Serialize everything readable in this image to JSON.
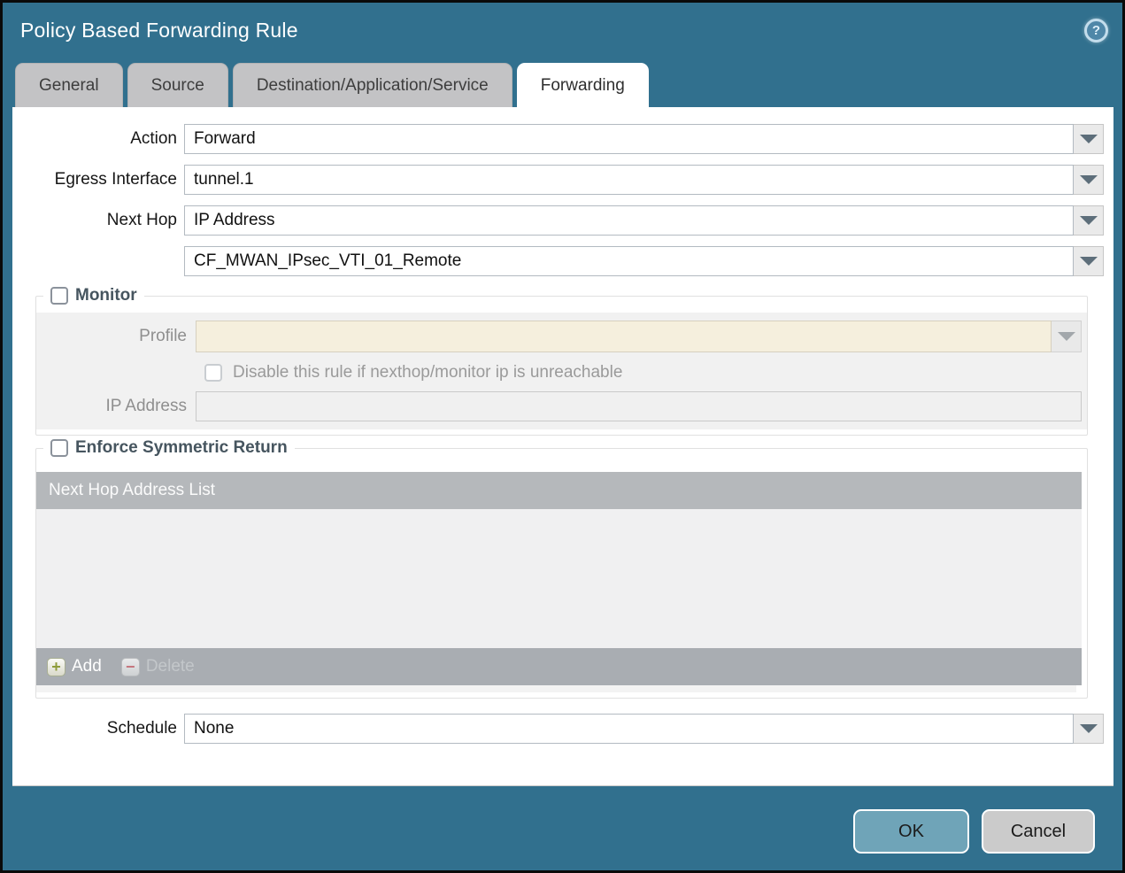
{
  "dialog": {
    "title": "Policy Based Forwarding Rule"
  },
  "icons": {
    "help": "?",
    "add": "+",
    "delete": "−"
  },
  "tabs": [
    {
      "label": "General",
      "active": false
    },
    {
      "label": "Source",
      "active": false
    },
    {
      "label": "Destination/Application/Service",
      "active": false
    },
    {
      "label": "Forwarding",
      "active": true
    }
  ],
  "form": {
    "action": {
      "label": "Action",
      "value": "Forward"
    },
    "egress_interface": {
      "label": "Egress Interface",
      "value": "tunnel.1"
    },
    "next_hop": {
      "label": "Next Hop",
      "value": "IP Address"
    },
    "next_hop_address": {
      "value": "CF_MWAN_IPsec_VTI_01_Remote"
    },
    "schedule": {
      "label": "Schedule",
      "value": "None"
    }
  },
  "monitor": {
    "legend": "Monitor",
    "checked": false,
    "profile_label": "Profile",
    "profile_value": "",
    "disable_checkbox_label": "Disable this rule if nexthop/monitor ip is unreachable",
    "disable_checked": false,
    "ip_address_label": "IP Address",
    "ip_address_value": ""
  },
  "symmetric_return": {
    "legend": "Enforce Symmetric Return",
    "checked": false,
    "table_header": "Next Hop Address List",
    "rows": [],
    "add_label": "Add",
    "delete_label": "Delete",
    "delete_enabled": false
  },
  "footer": {
    "ok_label": "OK",
    "cancel_label": "Cancel"
  },
  "colors": {
    "titlebar": "#31708E",
    "ok_button": "#6FA4B8",
    "cancel_button": "#CBCBCB",
    "table_header": "#B5B8BB",
    "table_footer": "#A9ADB2",
    "disabled_field": "#F5EFDD",
    "panel": "#F1F1F1"
  }
}
